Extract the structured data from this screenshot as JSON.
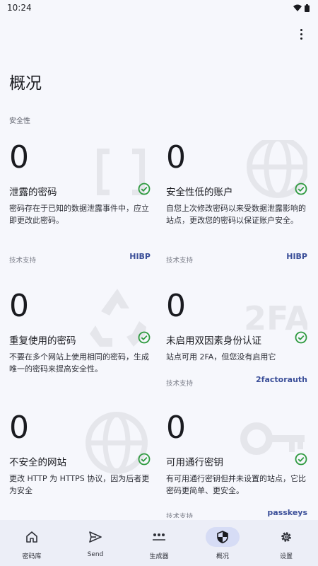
{
  "status_bar": {
    "time": "10:24"
  },
  "page": {
    "title": "概况",
    "section_label": "安全性"
  },
  "cards": [
    {
      "count": "0",
      "title": "泄露的密码",
      "description": "密码存在于已知的数据泄露事件中，应立即更改此密码。",
      "source_label": "技术支持",
      "source_link": "HIBP",
      "status_icon": "check-circle-icon",
      "background_icon": "bracket-icon"
    },
    {
      "count": "0",
      "title": "安全性低的账户",
      "description": "自您上次修改密码以来受数据泄露影响的站点，更改您的密码以保证账户安全。",
      "source_label": "技术支持",
      "source_link": "HIBP",
      "status_icon": "check-circle-icon",
      "background_icon": "globe-icon"
    },
    {
      "count": "0",
      "title": "重复使用的密码",
      "description": "不要在多个网站上使用相同的密码，生成唯一的密码来提高安全性。",
      "source_label": "",
      "source_link": "",
      "status_icon": "check-circle-icon",
      "background_icon": "recycle-icon"
    },
    {
      "count": "0",
      "title": "未启用双因素身份认证",
      "description": "站点可用 2FA，但您没有启用它",
      "source_label": "技术支持",
      "source_link": "2factorauth",
      "status_icon": "check-circle-icon",
      "background_icon": "2fa-icon"
    },
    {
      "count": "0",
      "title": "不安全的网站",
      "description": "更改 HTTP 为 HTTPS 协议，因为后者更为安全",
      "source_label": "",
      "source_link": "",
      "status_icon": "check-circle-icon",
      "background_icon": "globe-icon"
    },
    {
      "count": "0",
      "title": "可用通行密钥",
      "description": "有可用通行密钥但并未设置的站点，它比密码更简单、更安全。",
      "source_label": "技术支持",
      "source_link": "passkeys",
      "status_icon": "check-circle-icon",
      "background_icon": "key-icon"
    }
  ],
  "bottom_nav": [
    {
      "label": "密码库",
      "icon": "home-icon",
      "active": false
    },
    {
      "label": "Send",
      "icon": "send-icon",
      "active": false
    },
    {
      "label": "生成器",
      "icon": "generator-icon",
      "active": false
    },
    {
      "label": "概况",
      "icon": "shield-icon",
      "active": true
    },
    {
      "label": "设置",
      "icon": "gear-icon",
      "active": false
    }
  ],
  "colors": {
    "background": "#f6f7fc",
    "check_green": "#2e9a3f",
    "link_blue": "#3b4f99",
    "nav_background": "#eceef7",
    "nav_active_pill": "#d6dcf5"
  }
}
